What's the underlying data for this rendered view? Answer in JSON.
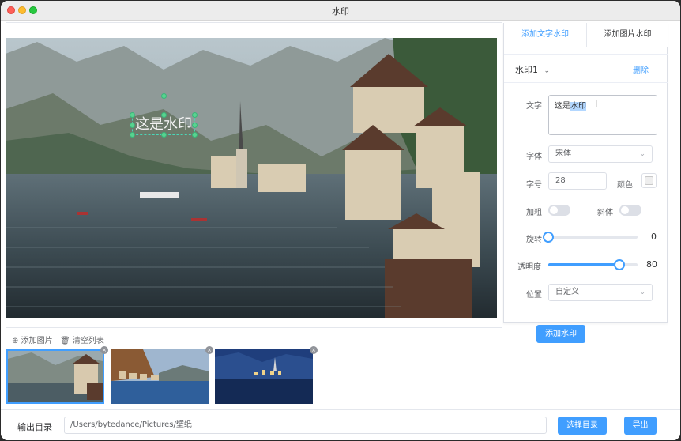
{
  "window": {
    "title": "水印"
  },
  "watermark_overlay": {
    "text": "这是水印"
  },
  "panel": {
    "tabs": [
      "添加文字水印",
      "添加图片水印"
    ],
    "active_tab": 0,
    "watermark_name": "水印1",
    "delete_label": "删除",
    "text_label": "文字",
    "text_before_highlight": "这是",
    "text_highlight": "水印",
    "font_label": "字体",
    "font_value": "宋体",
    "size_label": "字号",
    "size_value": "28",
    "color_label": "颜色",
    "color_value": "#eeeeee",
    "bold_label": "加粗",
    "bold_on": false,
    "italic_label": "斜体",
    "italic_on": false,
    "rotate_label": "旋转",
    "rotate_value": "0",
    "rotate_fraction": 0,
    "opacity_label": "透明度",
    "opacity_value": "80",
    "opacity_fraction": 0.8,
    "position_label": "位置",
    "position_value": "自定义",
    "add_button": "添加水印"
  },
  "toolbar": {
    "add_image": "添加图片",
    "clear_list": "清空列表"
  },
  "thumbnails": [
    {
      "name": "hallstatt-lake-day",
      "selected": true
    },
    {
      "name": "coastal-village-sunset",
      "selected": false
    },
    {
      "name": "hallstatt-night",
      "selected": false
    }
  ],
  "bottom": {
    "output_label": "输出目录",
    "output_path": "/Users/bytedance/Pictures/壁纸",
    "choose_button": "选择目录",
    "export_button": "导出"
  },
  "colors": {
    "accent": "#409eff",
    "handle": "#59d38f"
  }
}
